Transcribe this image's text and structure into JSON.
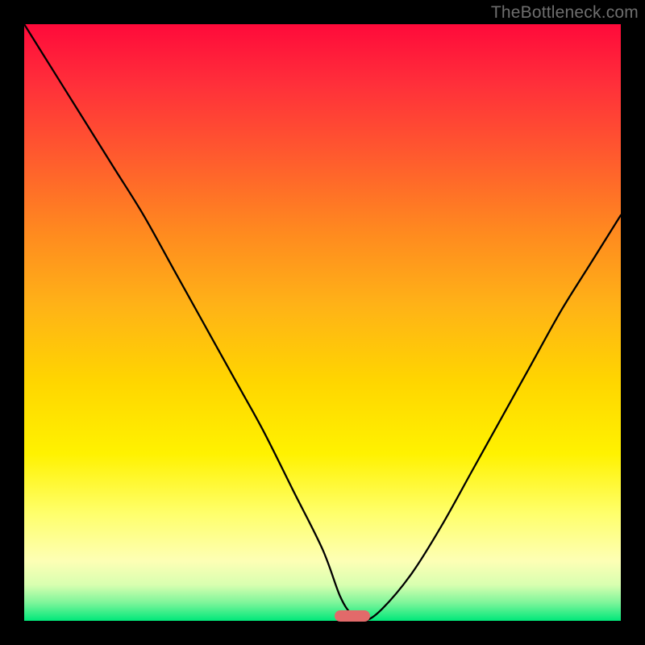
{
  "watermark": "TheBottleneck.com",
  "chart_data": {
    "type": "line",
    "title": "",
    "xlabel": "",
    "ylabel": "",
    "xlim": [
      0,
      100
    ],
    "ylim": [
      0,
      100
    ],
    "grid": false,
    "series": [
      {
        "name": "bottleneck-curve",
        "x": [
          0,
          5,
          10,
          15,
          20,
          25,
          30,
          35,
          40,
          45,
          50,
          53,
          55,
          57,
          60,
          65,
          70,
          75,
          80,
          85,
          90,
          95,
          100
        ],
        "y": [
          100,
          92,
          84,
          76,
          68,
          59,
          50,
          41,
          32,
          22,
          12,
          4,
          1,
          0,
          2,
          8,
          16,
          25,
          34,
          43,
          52,
          60,
          68
        ]
      }
    ],
    "annotations": [
      {
        "name": "optimal-marker",
        "x": 55,
        "y": 0.8,
        "color": "#e26a6a"
      }
    ],
    "background_gradient": {
      "top": "#ff0a3a",
      "bottom": "#00e87a"
    }
  }
}
